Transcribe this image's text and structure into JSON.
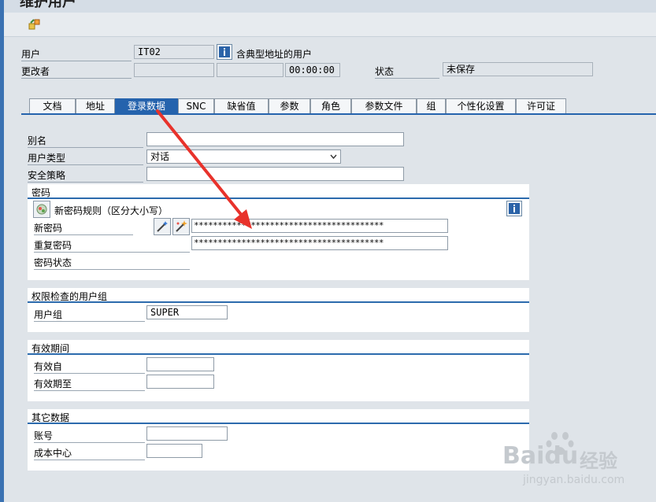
{
  "window": {
    "title": "维护用户"
  },
  "header": {
    "user_label": "用户",
    "user_value": "IT02",
    "user_desc": "含典型地址的用户",
    "changed_by_label": "更改者",
    "changed_by_value": "",
    "changed_date_value": "",
    "changed_time_value": "00:00:00",
    "status_label": "状态",
    "status_value": "未保存"
  },
  "tabs": [
    {
      "label": "文档"
    },
    {
      "label": "地址"
    },
    {
      "label": "登录数据",
      "active": true
    },
    {
      "label": "SNC"
    },
    {
      "label": "缺省值"
    },
    {
      "label": "参数"
    },
    {
      "label": "角色"
    },
    {
      "label": "参数文件"
    },
    {
      "label": "组"
    },
    {
      "label": "个性化设置"
    },
    {
      "label": "许可证"
    }
  ],
  "logon": {
    "alias_label": "别名",
    "alias_value": "",
    "user_type_label": "用户类型",
    "user_type_value": "对话",
    "security_policy_label": "安全策略",
    "security_policy_value": ""
  },
  "password": {
    "title": "密码",
    "rule_text": "新密码规则（区分大小写）",
    "new_label": "新密码",
    "new_value": "****************************************",
    "repeat_label": "重复密码",
    "repeat_value": "****************************************",
    "status_label": "密码状态"
  },
  "auth_group": {
    "title": "权限检查的用户组",
    "group_label": "用户组",
    "group_value": "SUPER"
  },
  "validity": {
    "title": "有效期间",
    "from_label": "有效自",
    "from_value": "",
    "to_label": "有效期至",
    "to_value": ""
  },
  "other": {
    "title": "其它数据",
    "account_label": "账号",
    "account_value": "",
    "cost_center_label": "成本中心",
    "cost_center_value": ""
  },
  "watermark": {
    "brand": "Baidu",
    "cn": "经验",
    "url": "jingyan.baidu.com"
  },
  "colors": {
    "accent": "#2563ad",
    "background": "#dfe4e9",
    "arrow": "#e8322b"
  }
}
